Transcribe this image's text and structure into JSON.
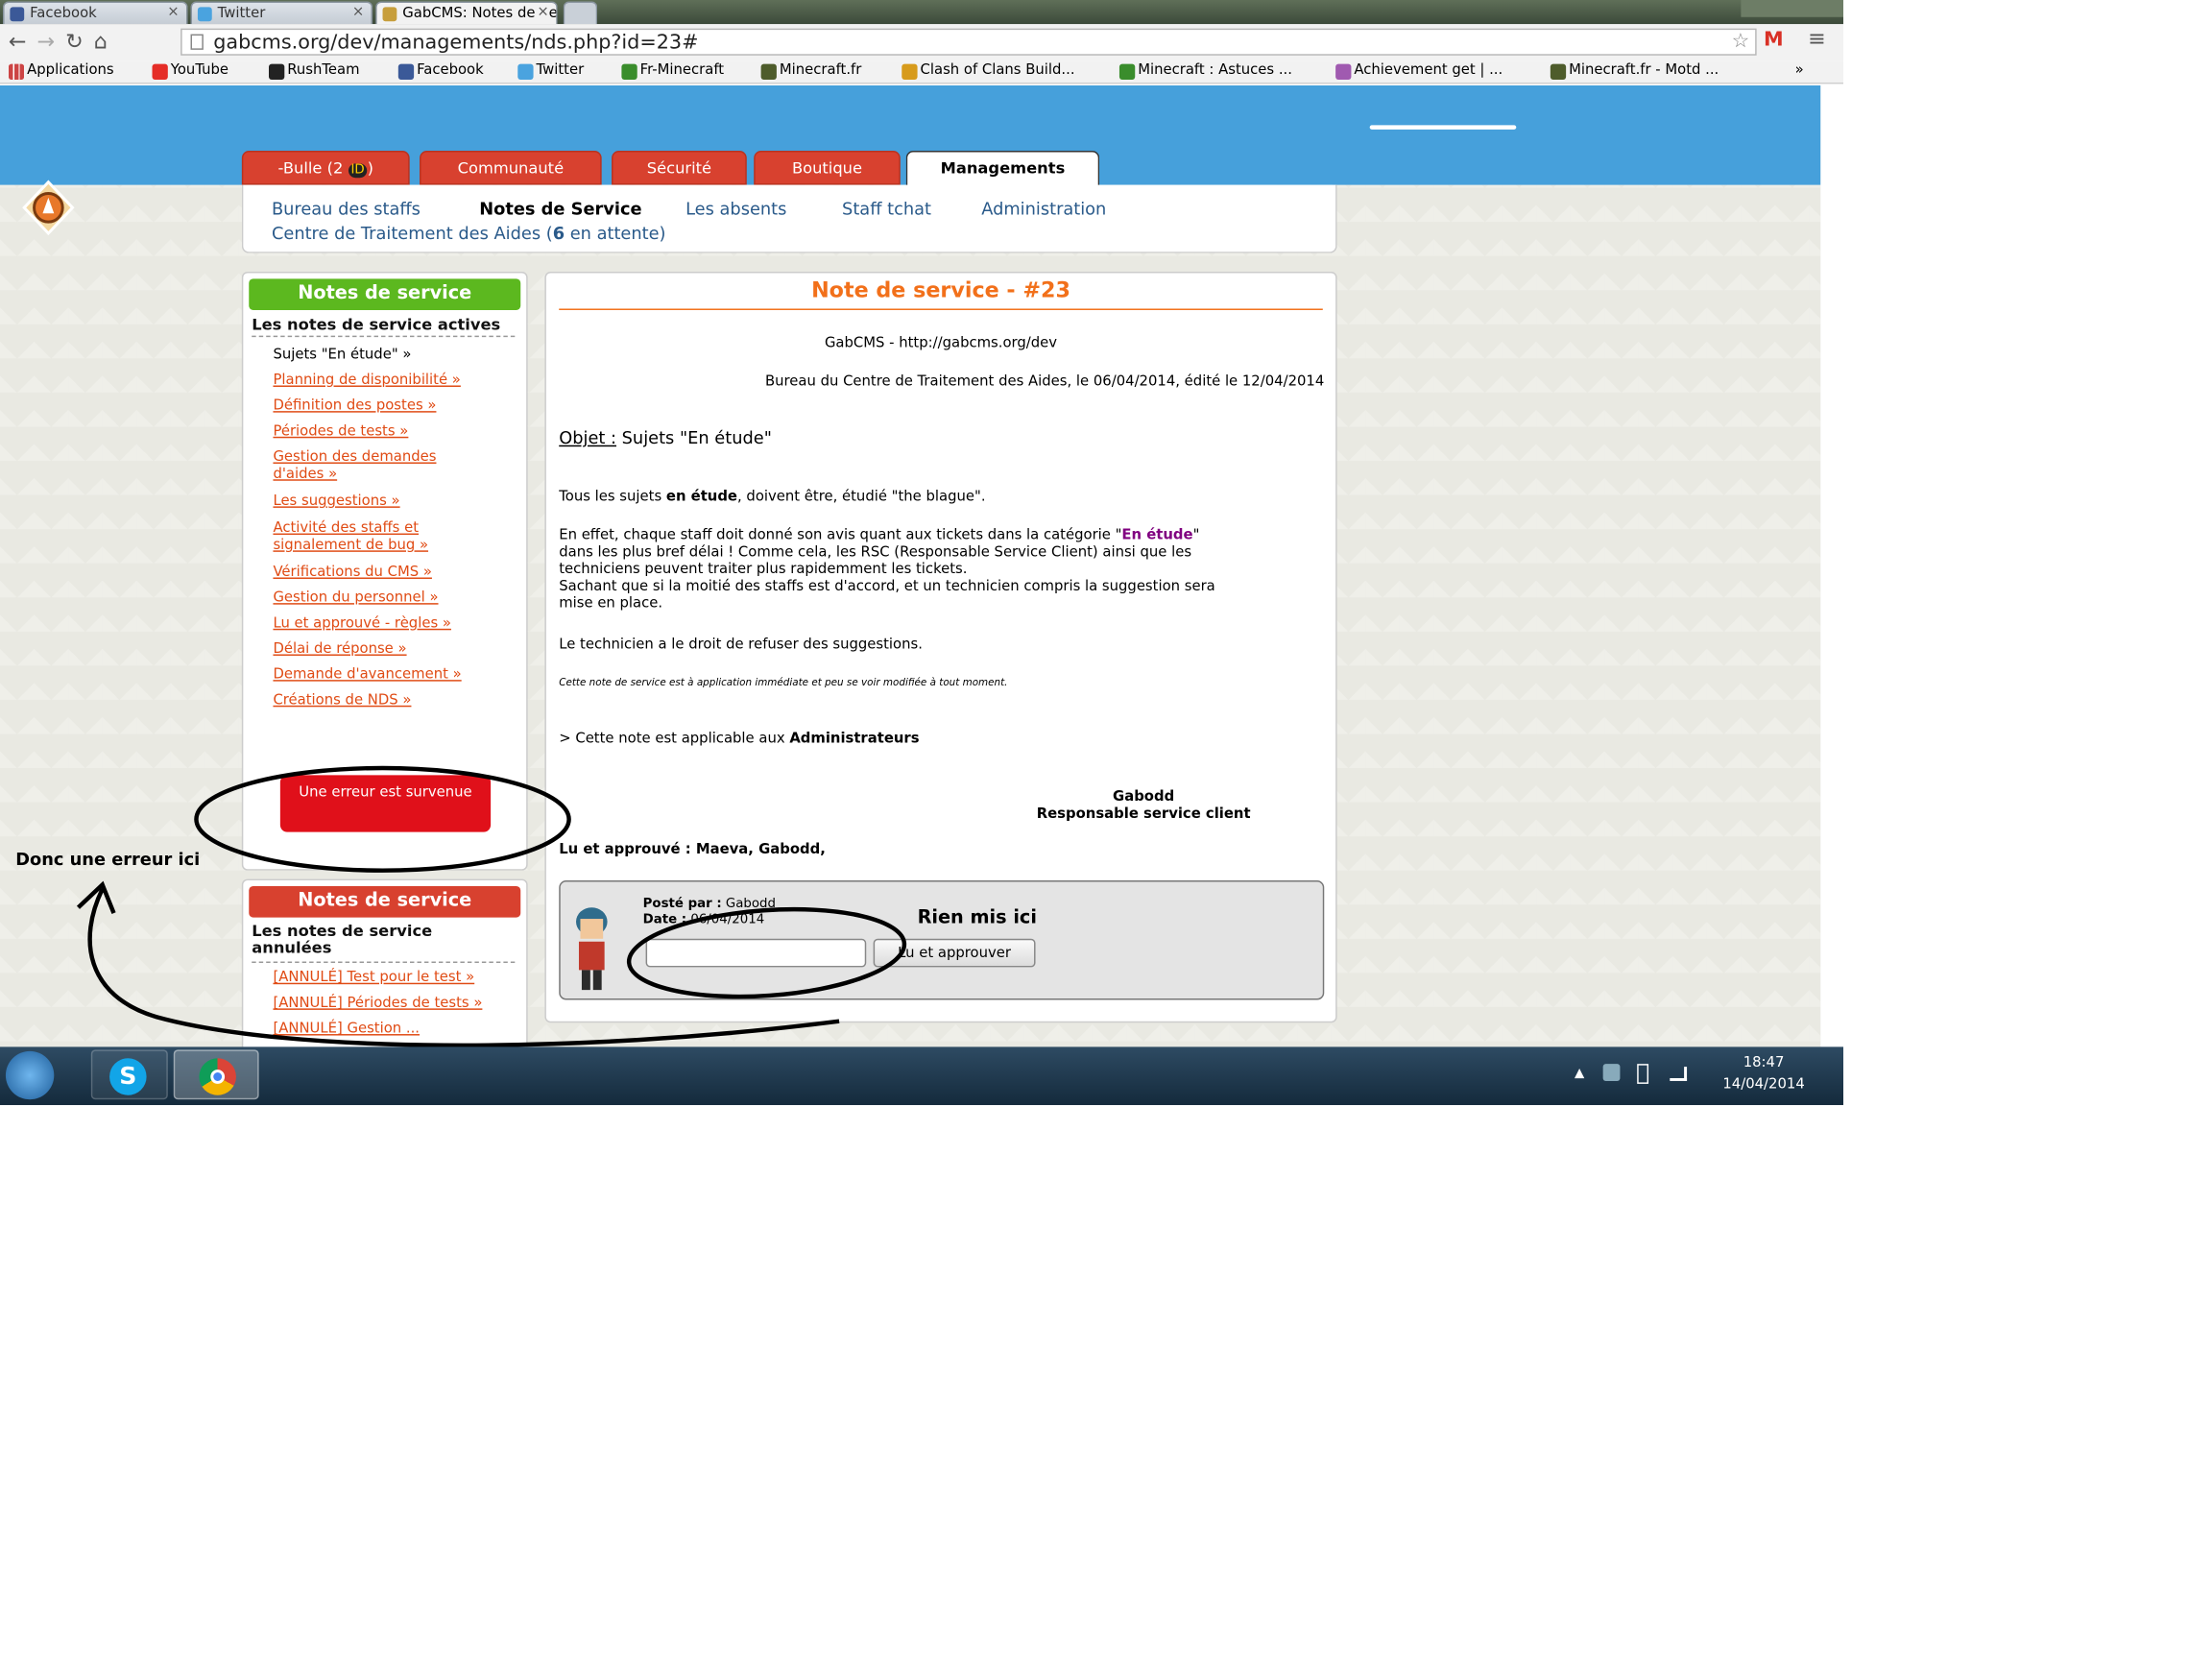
{
  "browser": {
    "tabs": [
      "Facebook",
      "Twitter",
      "GabCMS: Notes de Servic"
    ],
    "url": "gabcms.org/dev/managements/nds.php?id=23#",
    "bookmarks": [
      "Applications",
      "YouTube",
      "RushTeam",
      "Facebook",
      "Twitter",
      "Fr-Minecraft",
      "Minecraft.fr",
      "Clash of Clans Build...",
      "Minecraft : Astuces ...",
      "Achievement get | ...",
      "Minecraft.fr - Motd ..."
    ],
    "more": "»"
  },
  "site": {
    "menu_tabs": [
      "-Bulle (2 ",
      "Communauté",
      "Sécurité",
      "Boutique",
      "Managements"
    ],
    "menu_badge": "ID",
    "menu_bulle_close": ")",
    "subnav": [
      "Bureau des staffs",
      "Notes de Service",
      "Les absents",
      "Staff tchat",
      "Administration"
    ],
    "subnav_centre_pre": "Centre de Traitement des Aides (",
    "subnav_centre_count": "6",
    "subnav_centre_post": " en attente)"
  },
  "sidebar": {
    "title_active": "Notes de service",
    "heading_active": "Les notes de service actives",
    "current_item": "Sujets \"En étude\" »",
    "items": [
      "Planning de disponibilité »",
      "Définition des postes »",
      "Périodes de tests »",
      "Gestion des demandes d'aides »",
      "Les suggestions »",
      "Activité des staffs et signalement de bug »",
      "Vérifications du CMS »",
      "Gestion du personnel »",
      "Lu et approuvé - règles »",
      "Délai de réponse »",
      "Demande d'avancement »",
      "Créations de NDS »"
    ],
    "error_button": "Une erreur est survenue",
    "title_cancelled": "Notes de service",
    "heading_cancelled": "Les notes de service annulées",
    "cancelled_items": [
      "[ANNULÉ] Test pour le test »",
      "[ANNULÉ] Périodes de tests »",
      "[ANNULÉ] Gestion ..."
    ]
  },
  "note": {
    "title": "Note de service - #23",
    "org": "GabCMS - http://gabcms.org/dev",
    "meta": "Bureau du Centre de Traitement des Aides, le 06/04/2014, édité le 12/04/2014",
    "objet_label": "Objet :",
    "objet_value": " Sujets \"En étude\"",
    "p1_a": "Tous les sujets ",
    "p1_b": "en étude",
    "p1_c": ", doivent être, étudié \"the blague\".",
    "p2_l1a": "En effet, chaque staff doit donné son avis quant aux tickets dans la catégorie \"",
    "p2_l1b": "En étude",
    "p2_l1c": "\"",
    "p2_l2": "dans les plus bref délai ! Comme cela, les RSC (Responsable Service Client) ainsi que les",
    "p2_l3": "techniciens peuvent traiter plus rapidemment les tickets.",
    "p2_l4": "Sachant que si la moitié des staffs est d'accord, et un technicien compris la suggestion sera",
    "p2_l5": "mise en place.",
    "p3": "Le technicien a le droit de refuser des suggestions.",
    "p4": "Cette note de service est à application immédiate et peu se voir modifiée à tout moment.",
    "applicable_pre": "> Cette note est applicable aux ",
    "applicable_target": "Administrateurs",
    "signer": "Gabodd",
    "signer_role": "Responsable service client",
    "read_by": "Lu et approuvé : Maeva, Gabodd,",
    "posted_by_label": "Posté par :",
    "posted_by": " Gabodd",
    "date_label": "Date :",
    "date": " 06/04/2014",
    "input_value": "",
    "approve_button": "Lu et approuver"
  },
  "annotations": {
    "nothing_here": "Rien mis ici",
    "error_here": "Donc une erreur ici"
  },
  "taskbar": {
    "time": "18:47",
    "date": "14/04/2014"
  },
  "colors": {
    "accent_blue": "#46a0db",
    "menu_red": "#d8412f",
    "sidebar_green": "#5cb81f",
    "error_red": "#e0101a",
    "title_orange": "#f2701a"
  }
}
